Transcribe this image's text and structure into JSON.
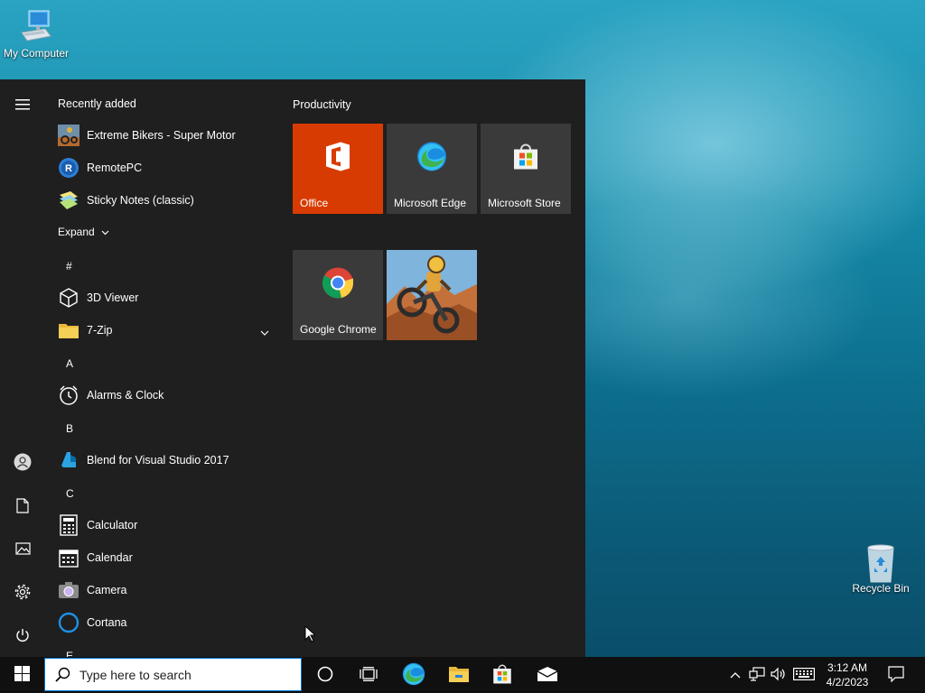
{
  "desktop": {
    "icons": [
      {
        "label": "My Computer",
        "icon": "computer-icon"
      },
      {
        "label": "Recycle Bin",
        "icon": "recycle-bin-icon"
      }
    ]
  },
  "start_menu": {
    "rail": [
      "hamburger-menu-icon",
      "user-icon",
      "documents-icon",
      "pictures-icon",
      "settings-icon",
      "power-icon"
    ],
    "recently_added": {
      "header": "Recently added",
      "items": [
        {
          "label": "Extreme Bikers - Super Motor",
          "icon": "extreme-bikers-icon"
        },
        {
          "label": "RemotePC",
          "icon": "remotepc-icon"
        },
        {
          "label": "Sticky Notes (classic)",
          "icon": "sticky-notes-icon"
        }
      ],
      "expand_label": "Expand"
    },
    "sections": [
      {
        "letter": "#",
        "items": [
          {
            "label": "3D Viewer",
            "icon": "cube-icon"
          },
          {
            "label": "7-Zip",
            "icon": "folder-icon",
            "expandable": true
          }
        ]
      },
      {
        "letter": "A",
        "items": [
          {
            "label": "Alarms & Clock",
            "icon": "alarm-clock-icon"
          }
        ]
      },
      {
        "letter": "B",
        "items": [
          {
            "label": "Blend for Visual Studio 2017",
            "icon": "blend-icon"
          }
        ]
      },
      {
        "letter": "C",
        "items": [
          {
            "label": "Calculator",
            "icon": "calculator-icon"
          },
          {
            "label": "Calendar",
            "icon": "calendar-icon"
          },
          {
            "label": "Camera",
            "icon": "camera-icon"
          },
          {
            "label": "Cortana",
            "icon": "cortana-icon"
          }
        ]
      },
      {
        "letter": "E",
        "items": []
      }
    ],
    "tiles": {
      "group_title": "Productivity",
      "items": [
        {
          "label": "Office",
          "icon": "office-icon",
          "color": "#d83b01"
        },
        {
          "label": "Microsoft Edge",
          "icon": "edge-icon",
          "color": "#3a3a3a"
        },
        {
          "label": "Microsoft Store",
          "icon": "store-icon",
          "color": "#3a3a3a"
        },
        {
          "label": "Google Chrome",
          "icon": "chrome-icon",
          "color": "#3a3a3a"
        },
        {
          "label": "",
          "icon": "extreme-bikers-tile-image",
          "color": "#c87a3a"
        }
      ]
    }
  },
  "taskbar": {
    "search_placeholder": "Type here to search",
    "pinned": [
      "cortana-circle-icon",
      "task-view-icon",
      "edge-icon",
      "file-explorer-icon",
      "store-icon",
      "mail-icon"
    ],
    "tray": [
      "chevron-up-icon",
      "network-icon",
      "volume-icon",
      "keyboard-icon"
    ],
    "time": "3:12 AM",
    "date": "4/2/2023",
    "notification_icon": "notification-icon"
  }
}
